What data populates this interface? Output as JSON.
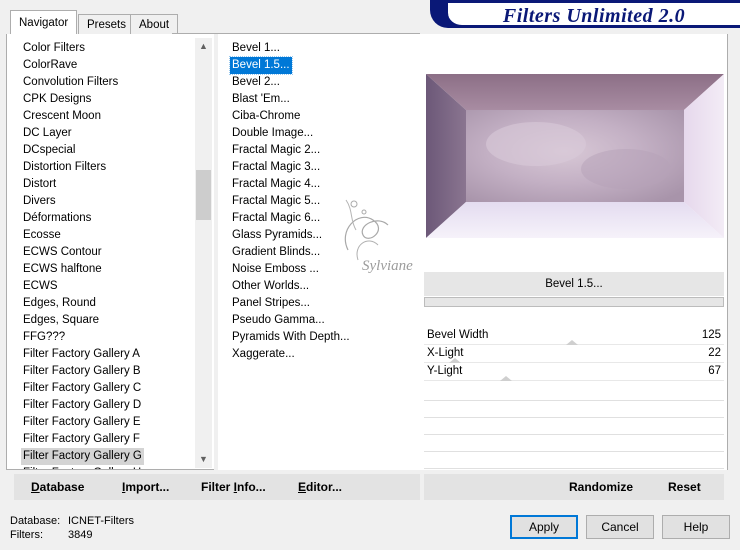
{
  "title": "Filters Unlimited 2.0",
  "tabs": [
    "Navigator",
    "Presets",
    "About"
  ],
  "categories": [
    "Color Filters",
    "ColorRave",
    "Convolution Filters",
    "CPK Designs",
    "Crescent Moon",
    "DC Layer",
    "DCspecial",
    "Distortion Filters",
    "Distort",
    "Divers",
    "Déformations",
    "Ecosse",
    "ECWS Contour",
    "ECWS halftone",
    "ECWS",
    "Edges, Round",
    "Edges, Square",
    "FFG???",
    "Filter Factory Gallery A",
    "Filter Factory Gallery B",
    "Filter Factory Gallery C",
    "Filter Factory Gallery D",
    "Filter Factory Gallery E",
    "Filter Factory Gallery F",
    "Filter Factory Gallery G",
    "Filter Factory Gallery H"
  ],
  "selected_category": "Filter Factory Gallery G",
  "filters": [
    "Bevel 1...",
    "Bevel 1.5...",
    "Bevel 2...",
    "Blast 'Em...",
    "Ciba-Chrome",
    "Double Image...",
    "Fractal Magic 2...",
    "Fractal Magic 3...",
    "Fractal Magic 4...",
    "Fractal Magic 5...",
    "Fractal Magic 6...",
    "Glass Pyramids...",
    "Gradient Blinds...",
    "Noise Emboss ...",
    "Other Worlds...",
    "Panel Stripes...",
    "Pseudo Gamma...",
    "Pyramids With Depth...",
    "Xaggerate..."
  ],
  "selected_filter": "Bevel 1.5...",
  "current_filter_label": "Bevel 1.5...",
  "params": [
    {
      "label": "Bevel Width",
      "value": 125,
      "level": 0.49
    },
    {
      "label": "X-Light",
      "value": 22,
      "level": 0.086
    },
    {
      "label": "Y-Light",
      "value": 67,
      "level": 0.263
    }
  ],
  "left_buttons": [
    {
      "label": "Database",
      "underline": "D",
      "rest": "atabase"
    },
    {
      "label": "Import...",
      "underline": "I",
      "rest": "mport..."
    },
    {
      "label": "Filter Info...",
      "underline": "",
      "pre": "Filter ",
      "u2": "I",
      "rest2": "nfo..."
    },
    {
      "label": "Editor...",
      "underline": "E",
      "rest": "ditor..."
    }
  ],
  "right_buttons": {
    "randomize": "Randomize",
    "reset": "Reset"
  },
  "status": {
    "database_label": "Database:",
    "database_value": "ICNET-Filters",
    "filters_label": "Filters:",
    "filters_value": "3849"
  },
  "dialog": {
    "apply": "Apply",
    "cancel": "Cancel",
    "help": "Help"
  },
  "watermark_text": "Sylviane",
  "colors": {
    "banner": "#0a1877",
    "selection": "#0078d7"
  }
}
